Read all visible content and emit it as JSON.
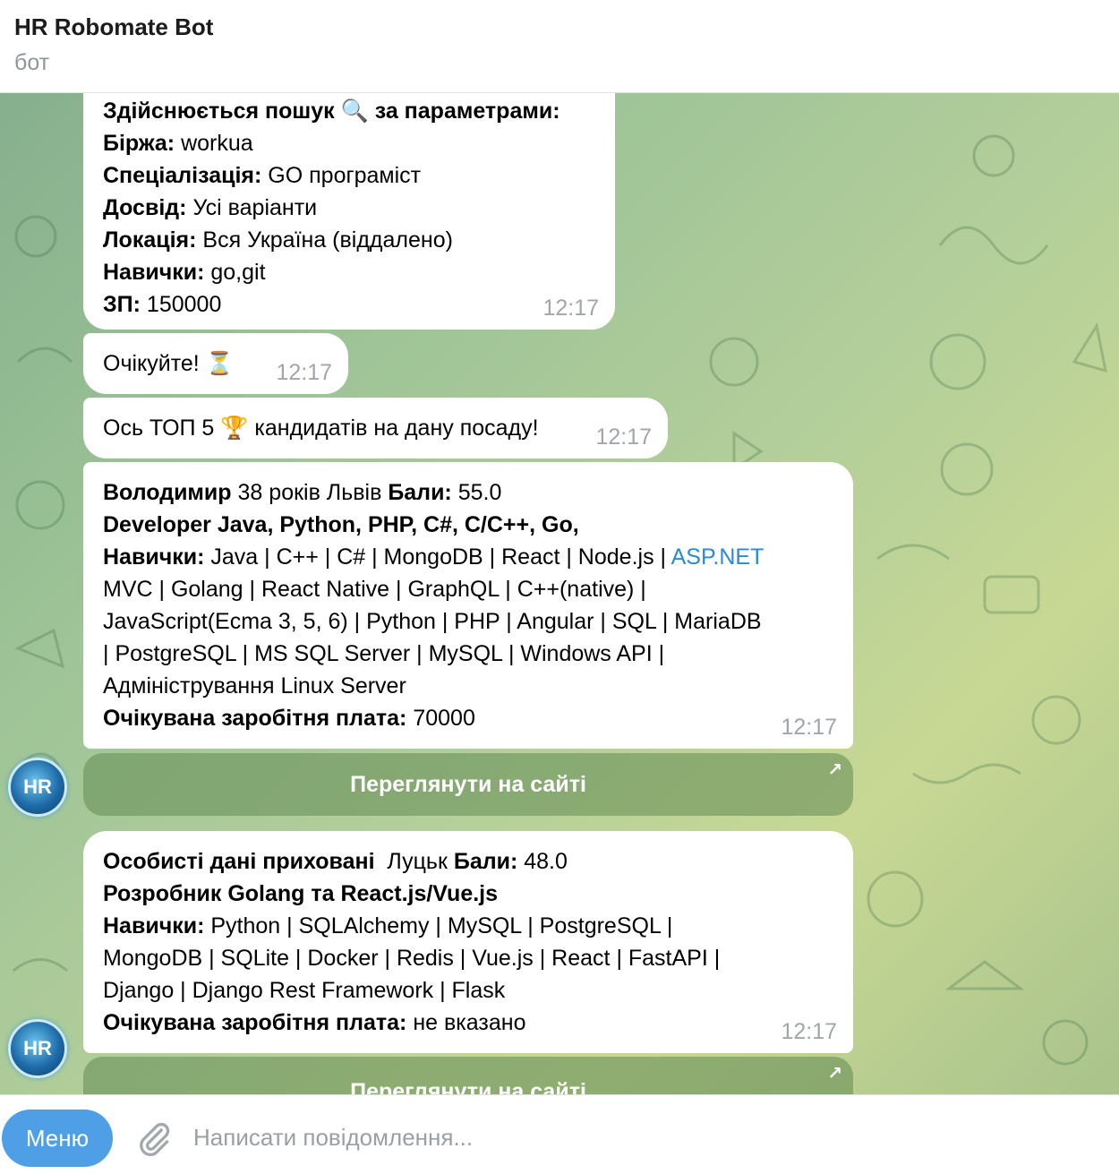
{
  "header": {
    "title": "HR Robomate Bot",
    "subtitle": "бот"
  },
  "messages": {
    "search": {
      "heading_a": "Здійснюється пошук",
      "heading_emoji": "🔍",
      "heading_b": "за параметрами:",
      "exchange_label": "Біржа:",
      "exchange": "workua",
      "spec_label": "Спеціалізація:",
      "spec": "GO програміст",
      "exp_label": "Досвід:",
      "exp": "Усі варіанти",
      "loc_label": "Локація:",
      "loc": "Вся Україна (віддалено)",
      "skills_label": "Навички:",
      "skills": "go,git",
      "salary_label": "ЗП:",
      "salary": "150000",
      "time": "12:17"
    },
    "wait": {
      "text": "Очікуйте!",
      "emoji": "⏳",
      "time": "12:17"
    },
    "top": {
      "text_a": "Ось ТОП 5",
      "emoji": "🏆",
      "text_b": "кандидатів на дану посаду!",
      "time": "12:17"
    },
    "cand1": {
      "name": "Володимир",
      "info": "38 років Львів",
      "score_label": "Бали:",
      "score": "55.0",
      "title": "Developer Java, Python, PHP, C#, C/C++, Go,",
      "skills_label": "Навички:",
      "skills_1": "Java | C++ | C# | MongoDB | React | Node.js |",
      "skills_link": "ASP.NET",
      "skills_2": "MVC | Golang | React Native | GraphQL | C++(native) |",
      "skills_3": "JavaScript(Ecma 3, 5, 6) | Python | PHP | Angular | SQL | MariaDB",
      "skills_4": "| PostgreSQL | MS SQL Server | MySQL | Windows API |",
      "skills_5": "Адміністрування Linux Server",
      "salary_label": "Очікувана заробітня плата:",
      "salary": "70000",
      "time": "12:17",
      "button": "Переглянути на сайті"
    },
    "cand2": {
      "name": "Особисті дані приховані",
      "info": "Луцьк",
      "score_label": "Бали:",
      "score": "48.0",
      "title": "Розробник Golang та React.js/Vue.js",
      "skills_label": "Навички:",
      "skills_1": "Python | SQLAlchemy | MySQL | PostgreSQL |",
      "skills_2": "MongoDB | SQLite | Docker | Redis | Vue.js | React | FastAPI |",
      "skills_3": "Django | Django Rest Framework | Flask",
      "salary_label": "Очікувана заробітня плата:",
      "salary": "не вказано",
      "time": "12:17",
      "button": "Переглянути на сайті"
    }
  },
  "avatar": {
    "initials": "HR"
  },
  "composer": {
    "menu_label": "Меню",
    "placeholder": "Написати повідомлення..."
  },
  "colors": {
    "accent": "#4f9fe6",
    "link": "#2a8ad4",
    "time": "#a0a6ab"
  }
}
